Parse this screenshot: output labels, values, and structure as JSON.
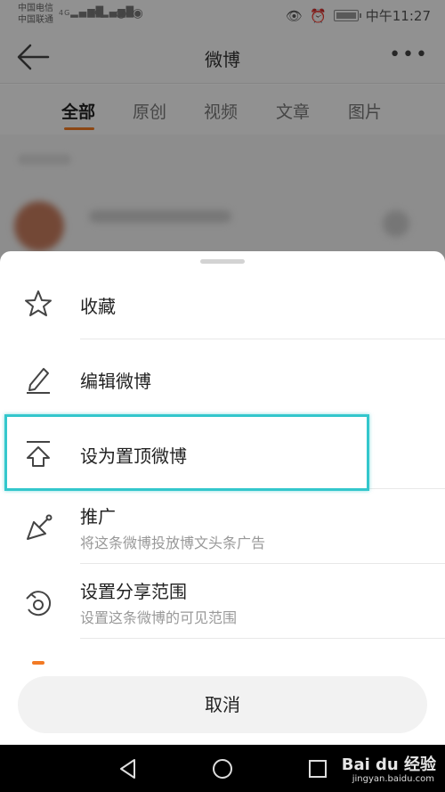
{
  "status_bar": {
    "carrier_1": "中国电信",
    "carrier_2": "中国联通",
    "signal_1": "4G",
    "signal_2": "3G",
    "time": "中午11:27"
  },
  "header": {
    "title": "微博"
  },
  "tabs": [
    {
      "label": "全部",
      "active": true
    },
    {
      "label": "原创",
      "active": false
    },
    {
      "label": "视频",
      "active": false
    },
    {
      "label": "文章",
      "active": false
    },
    {
      "label": "图片",
      "active": false
    }
  ],
  "sheet": {
    "items": [
      {
        "icon": "star-icon",
        "label": "收藏",
        "sub": ""
      },
      {
        "icon": "edit-icon",
        "label": "编辑微博",
        "sub": ""
      },
      {
        "icon": "pin-top-icon",
        "label": "设为置顶微博",
        "sub": ""
      },
      {
        "icon": "promote-icon",
        "label": "推广",
        "sub": "将这条微博投放博文头条广告"
      },
      {
        "icon": "share-scope-icon",
        "label": "设置分享范围",
        "sub": "设置这条微博的可见范围"
      }
    ],
    "cancel_label": "取消"
  },
  "watermark": {
    "brand": "Bai du 经验",
    "url": "jingyan.baidu.com"
  },
  "colors": {
    "accent": "#f27a24",
    "highlight": "#33c7cc"
  }
}
